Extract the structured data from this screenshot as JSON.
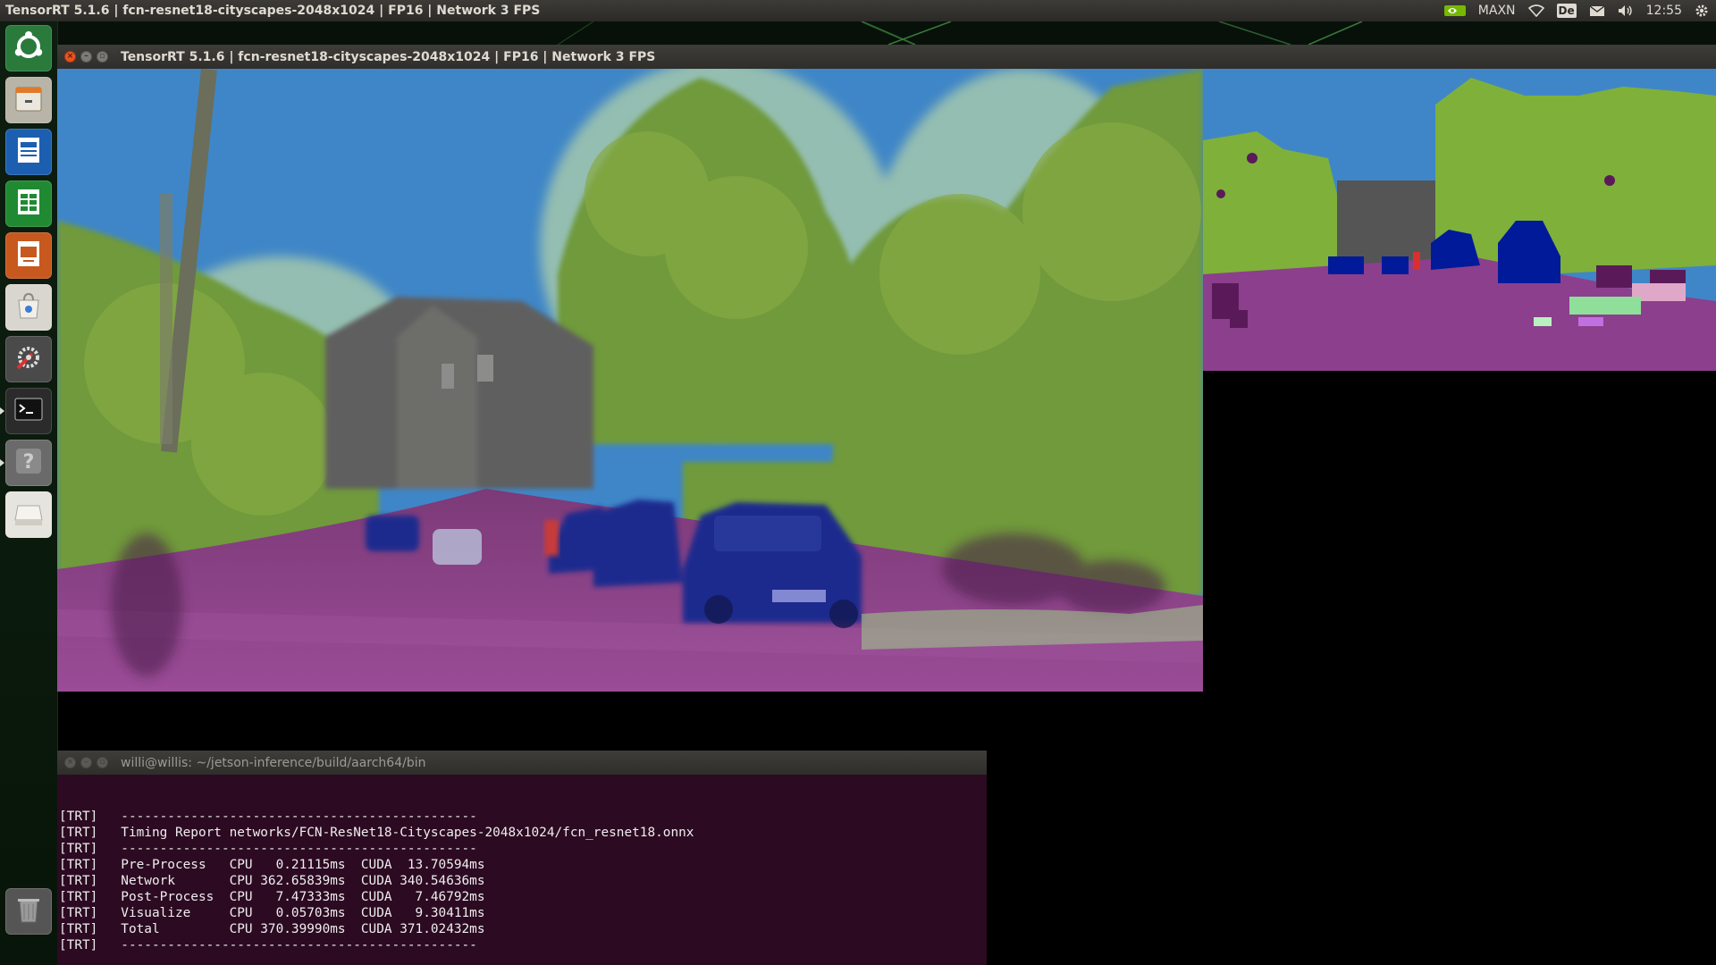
{
  "top_panel": {
    "title": "TensorRT 5.1.6 | fcn-resnet18-cityscapes-2048x1024 | FP16 | Network 3 FPS",
    "power_mode": "MAXN",
    "keyboard_layout": "De",
    "clock": "12:55",
    "icons": [
      "nvidia-icon",
      "wifi-icon",
      "keyboard-layout-icon",
      "mail-icon",
      "volume-icon",
      "settings-gear-icon"
    ]
  },
  "launcher": {
    "items": [
      {
        "name": "dash-home",
        "icon": "ubuntu-logo-icon",
        "color": "#2a7a3c"
      },
      {
        "name": "files",
        "icon": "file-cabinet-icon",
        "color": "#b8b4a8"
      },
      {
        "name": "writer",
        "icon": "document-icon",
        "color": "#1c5fb0"
      },
      {
        "name": "calc",
        "icon": "spreadsheet-icon",
        "color": "#1f8a32"
      },
      {
        "name": "impress",
        "icon": "presentation-icon",
        "color": "#c7591e"
      },
      {
        "name": "software-center",
        "icon": "shopping-bag-icon",
        "color": "#d9d6cf"
      },
      {
        "name": "system-settings",
        "icon": "tools-icon",
        "color": "#4a4a4a"
      },
      {
        "name": "terminal",
        "icon": "terminal-icon",
        "color": "#2b2b2b"
      },
      {
        "name": "help",
        "icon": "help-icon",
        "color": "#6a6a6a"
      },
      {
        "name": "drive",
        "icon": "disk-icon",
        "color": "#e6e4de"
      },
      {
        "name": "trash",
        "icon": "trash-icon",
        "color": "#555"
      }
    ]
  },
  "main_window": {
    "title": "TensorRT 5.1.6 | fcn-resnet18-cityscapes-2048x1024 | FP16 | Network 3 FPS"
  },
  "terminal_window": {
    "title": "willi@willis: ~/jetson-inference/build/aarch64/bin",
    "lines": [
      "[TRT]   ----------------------------------------------",
      "[TRT]   Timing Report networks/FCN-ResNet18-Cityscapes-2048x1024/fcn_resnet18.onnx",
      "[TRT]   ----------------------------------------------",
      "[TRT]   Pre-Process   CPU   0.21115ms  CUDA  13.70594ms",
      "[TRT]   Network       CPU 362.65839ms  CUDA 340.54636ms",
      "[TRT]   Post-Process  CPU   7.47333ms  CUDA   7.46792ms",
      "[TRT]   Visualize     CPU   0.05703ms  CUDA   9.30411ms",
      "[TRT]   Total         CPU 370.39990ms  CUDA 371.02432ms",
      "[TRT]   ----------------------------------------------"
    ]
  },
  "colors": {
    "sky": "#3f86c8",
    "vegetation": "#7fa33a",
    "building": "#5a5a5a",
    "road": "#8a3c8a",
    "car": "#1c2a8c",
    "terminal_bg": "#2c0a22"
  }
}
